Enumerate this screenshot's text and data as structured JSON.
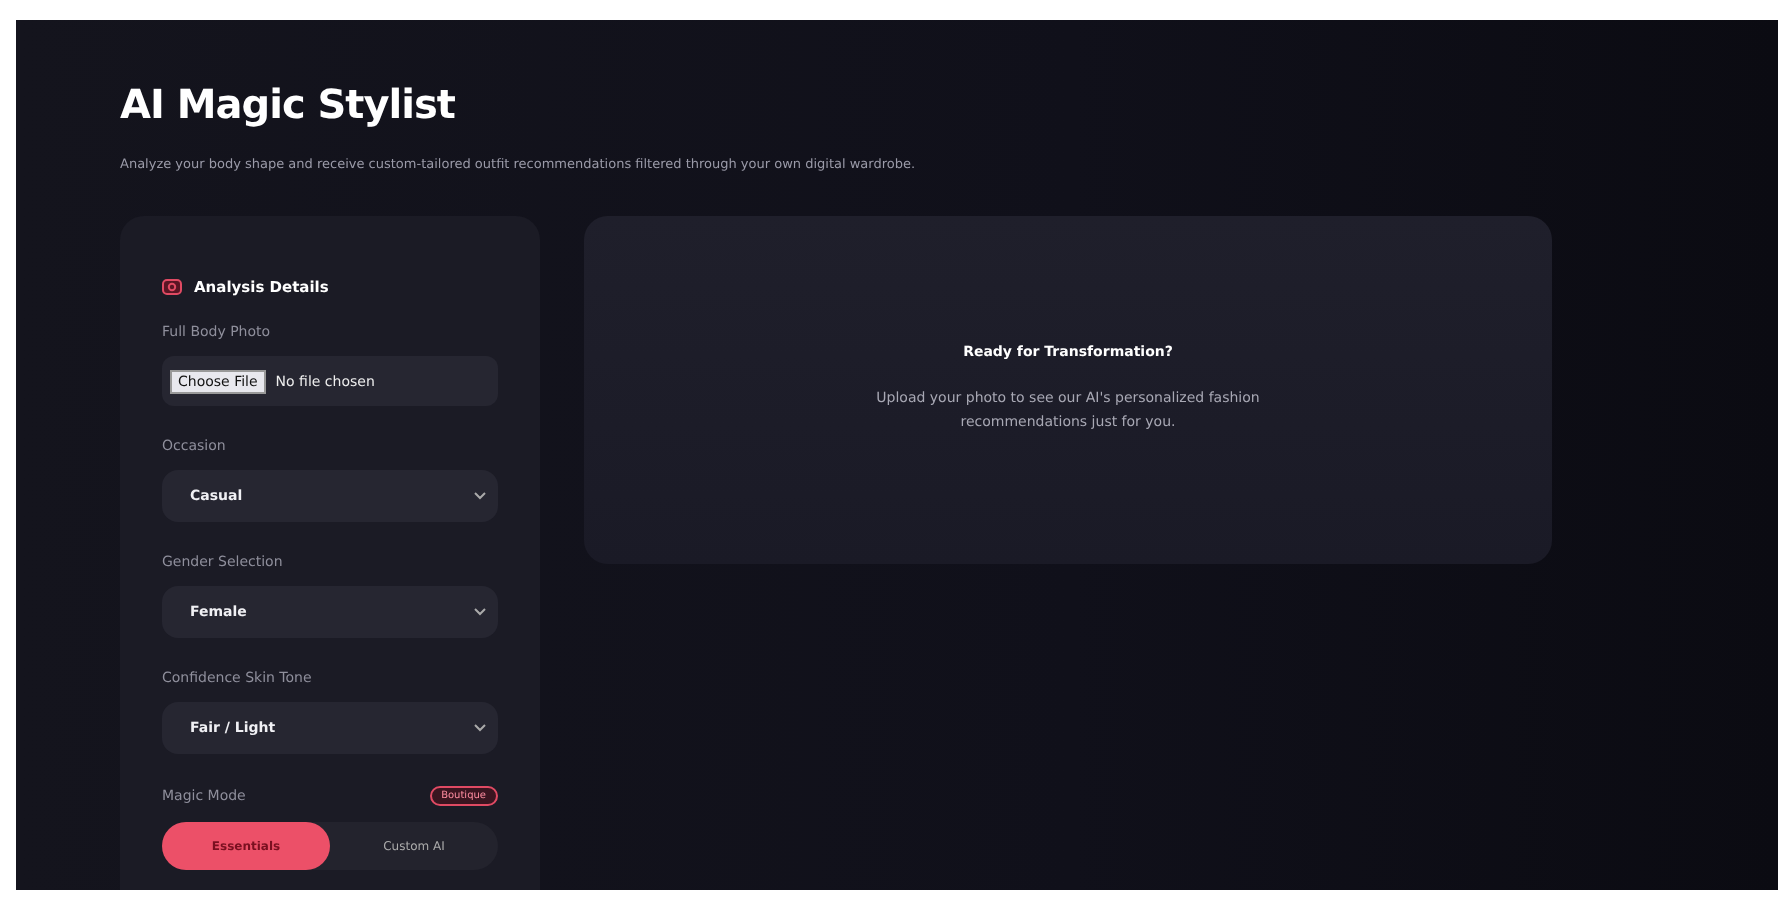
{
  "title": "AI Magic Stylist",
  "subtitle": "Analyze your body shape and receive custom-tailored outfit recommendations filtered through your own digital wardrobe.",
  "panel": {
    "heading": "Analysis Details",
    "photo": {
      "label": "Full Body Photo",
      "button": "Choose File",
      "status": "No file chosen"
    },
    "selects": [
      {
        "label": "Occasion",
        "value": "Casual"
      },
      {
        "label": "Gender Selection",
        "value": "Female"
      },
      {
        "label": "Confidence Skin Tone",
        "value": "Fair / Light"
      }
    ],
    "mode": {
      "label": "Magic Mode",
      "badge": "Boutique",
      "options": [
        {
          "label": "Essentials",
          "selected": true
        },
        {
          "label": "Custom AI",
          "selected": false
        }
      ]
    }
  },
  "result": {
    "heading": "Ready for Transformation?",
    "text": "Upload your photo to see our AI's personalized fashion recommendations just for you."
  }
}
